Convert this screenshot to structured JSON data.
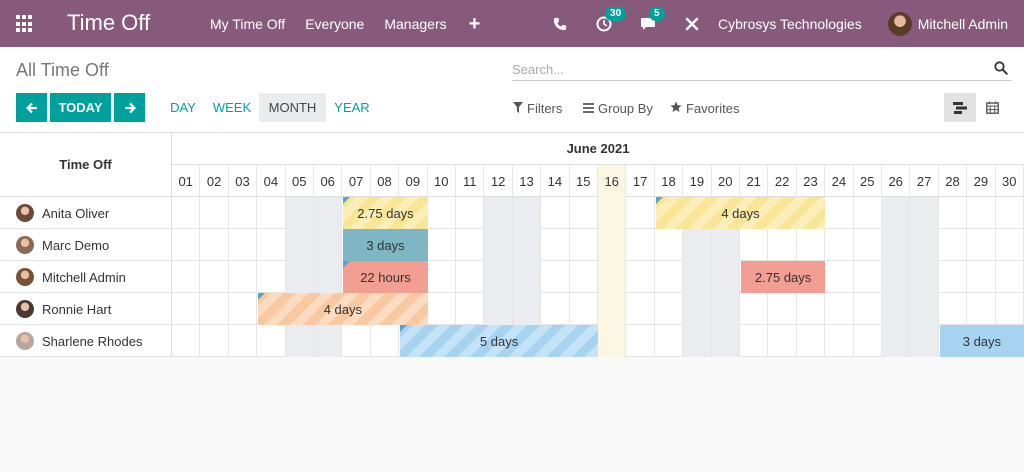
{
  "navbar": {
    "app_title": "Time Off",
    "menu": [
      "My Time Off",
      "Everyone",
      "Managers"
    ],
    "activity_count": "30",
    "message_count": "5",
    "company": "Cybrosys Technologies",
    "user": "Mitchell Admin"
  },
  "control": {
    "breadcrumb": "All Time Off",
    "search_placeholder": "Search...",
    "today_label": "TODAY",
    "scales": [
      "DAY",
      "WEEK",
      "MONTH",
      "YEAR"
    ],
    "active_scale": "MONTH",
    "filters_label": "Filters",
    "groupby_label": "Group By",
    "favorites_label": "Favorites"
  },
  "gantt": {
    "row_header": "Time Off",
    "month_label": "June 2021",
    "days": [
      "01",
      "02",
      "03",
      "04",
      "05",
      "06",
      "07",
      "08",
      "09",
      "10",
      "11",
      "12",
      "13",
      "14",
      "15",
      "16",
      "17",
      "18",
      "19",
      "20",
      "21",
      "22",
      "23",
      "24",
      "25",
      "26",
      "27",
      "28",
      "29",
      "30"
    ],
    "today_day": 16,
    "weekend_days": [
      5,
      6,
      12,
      13,
      19,
      20,
      26,
      27
    ],
    "rows": [
      {
        "name": "Anita Oliver",
        "avatar_color": "#6b4a3a"
      },
      {
        "name": "Marc Demo",
        "avatar_color": "#8a6a55"
      },
      {
        "name": "Mitchell Admin",
        "avatar_color": "#7a5238"
      },
      {
        "name": "Ronnie Hart",
        "avatar_color": "#4a3a34"
      },
      {
        "name": "Sharlene Rhodes",
        "avatar_color": "#b9a6a3"
      }
    ],
    "leaves": [
      {
        "row": 0,
        "start": 7,
        "end": 9,
        "label": "2.75 days",
        "style": "striped-yellow",
        "corner": true
      },
      {
        "row": 0,
        "start": 18,
        "end": 23,
        "label": "4 days",
        "style": "striped-yellow",
        "corner": true
      },
      {
        "row": 1,
        "start": 7,
        "end": 9,
        "label": "3 days",
        "style": "solid-teal",
        "corner": false
      },
      {
        "row": 2,
        "start": 7,
        "end": 9,
        "label": "22 hours",
        "style": "solid-red",
        "corner": true
      },
      {
        "row": 2,
        "start": 21,
        "end": 23,
        "label": "2.75 days",
        "style": "solid-red",
        "corner": false
      },
      {
        "row": 3,
        "start": 4,
        "end": 9,
        "label": "4 days",
        "style": "striped-orange",
        "corner": true
      },
      {
        "row": 4,
        "start": 9,
        "end": 15,
        "label": "5 days",
        "style": "striped-blue",
        "corner": true
      },
      {
        "row": 4,
        "start": 28,
        "end": 30,
        "label": "3 days",
        "style": "solid-blue",
        "corner": false
      }
    ]
  }
}
